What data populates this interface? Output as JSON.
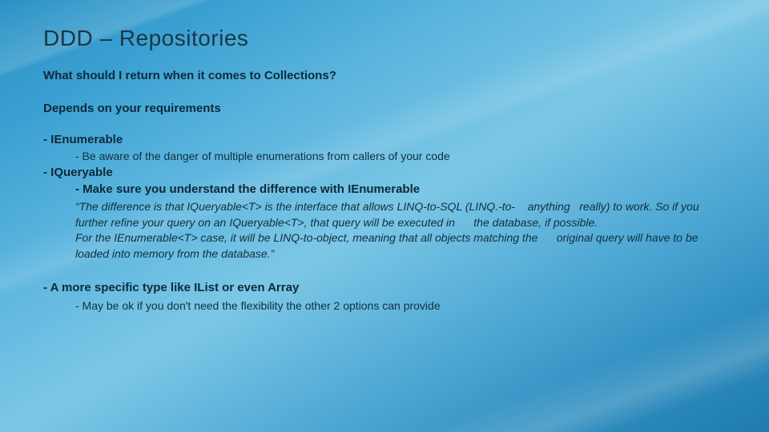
{
  "title": "DDD – Repositories",
  "question": "What should I return when it comes to Collections?",
  "depends": "Depends on your requirements",
  "item1": {
    "label": "-   IEnumerable",
    "sub": "-    Be aware of the danger of multiple enumerations from callers of your code"
  },
  "item2": {
    "label": "-   IQueryable",
    "sub": "-   Make sure you understand the difference with IEnumerable",
    "quote": "“The difference is that IQueryable<T> is the interface that allows LINQ-to-SQL (LINQ.-to-    anything   really) to work. So if you further refine your query on an IQueryable<T>, that query will be executed in      the database, if possible.\n        For the IEnumerable<T> case, it will be LINQ-to-object, meaning that all objects matching the      original query will have to be loaded into memory from the database.”"
  },
  "item3": {
    "label": "-   A more specific type like IList or even Array",
    "sub": "-    May be ok if you don't need the flexibility the other 2 options can provide"
  }
}
